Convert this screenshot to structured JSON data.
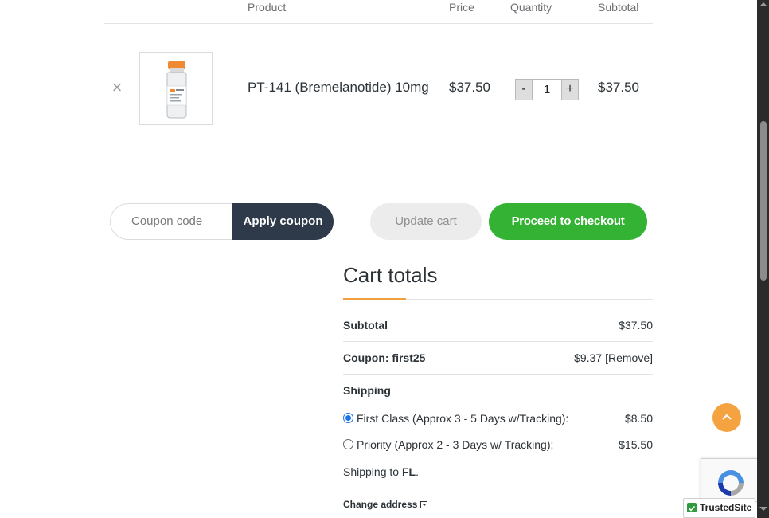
{
  "cart_table": {
    "headers": {
      "product": "Product",
      "price": "Price",
      "quantity": "Quantity",
      "subtotal": "Subtotal"
    },
    "items": [
      {
        "remove_glyph": "×",
        "thumbnail_icon": "vial-product-image",
        "name": "PT-141 (Bremelanotide) 10mg",
        "price": "$37.50",
        "quantity": "1",
        "subtotal": "$37.50"
      }
    ],
    "qty_minus": "-",
    "qty_plus": "+"
  },
  "actions": {
    "coupon_placeholder": "Coupon code",
    "apply_coupon": "Apply coupon",
    "update_cart": "Update cart",
    "proceed_checkout": "Proceed to checkout"
  },
  "cart_totals": {
    "title": "Cart totals",
    "subtotal_label": "Subtotal",
    "subtotal_value": "$37.50",
    "coupon_label": "Coupon: first25",
    "coupon_value": "-$9.37",
    "coupon_remove": "[Remove]",
    "shipping_label": "Shipping",
    "shipping_options": [
      {
        "label": "First Class (Approx 3 - 5 Days w/Tracking):",
        "price": "$8.50",
        "selected": true
      },
      {
        "label": "Priority (Approx 2 - 3 Days w/ Tracking):",
        "price": "$15.50",
        "selected": false
      }
    ],
    "shipping_to_prefix": "Shipping to ",
    "shipping_to_state": "FL",
    "shipping_to_suffix": ".",
    "change_address": "Change address"
  },
  "widgets": {
    "trusted_site": "TrustedSite",
    "scroll_top_icon": "chevron-up-icon",
    "recaptcha_icon": "recaptcha-icon"
  },
  "colors": {
    "checkout_green": "#34b233",
    "apply_dark": "#2e3a4a",
    "accent_orange": "#f0a03c",
    "scroll_top_orange": "#f5a340"
  }
}
